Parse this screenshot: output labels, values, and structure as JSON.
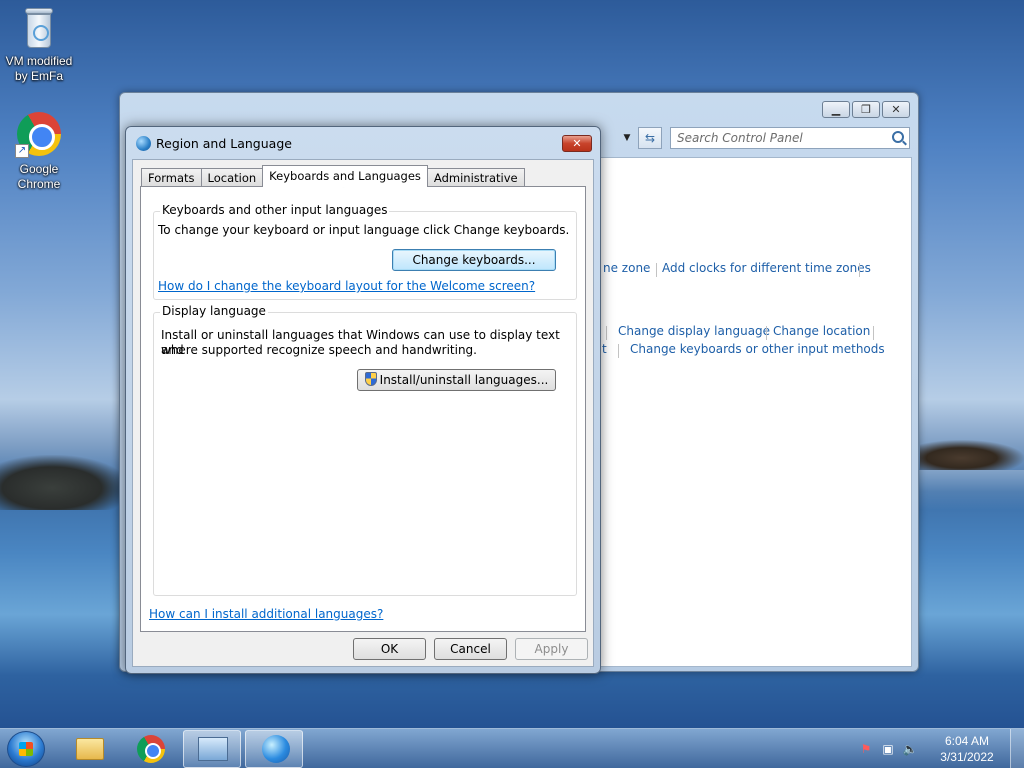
{
  "desktop": {
    "icons": [
      {
        "label": "VM modified by EmFa"
      },
      {
        "label": "Google Chrome"
      }
    ]
  },
  "control_panel": {
    "search_placeholder": "Search Control Panel",
    "links": {
      "time_zone_fragment": "ne zone",
      "add_clocks": "Add clocks for different time zones",
      "change_display_language": "Change display language",
      "change_location": "Change location",
      "fragment_t": "t",
      "change_keyboards": "Change keyboards or other input methods"
    }
  },
  "dialog": {
    "title": "Region and Language",
    "tabs": [
      "Formats",
      "Location",
      "Keyboards and Languages",
      "Administrative"
    ],
    "active_tab": "Keyboards and Languages",
    "keyboards_group": {
      "title": "Keyboards and other input languages",
      "description": "To change your keyboard or input language click Change keyboards.",
      "change_button": "Change keyboards...",
      "help_link": "How do I change the keyboard layout for the Welcome screen?"
    },
    "display_group": {
      "title": "Display language",
      "description_line1": "Install or uninstall languages that Windows can use to display text and",
      "description_line2": "where supported recognize speech and handwriting.",
      "install_button": "Install/uninstall languages..."
    },
    "additional_link": "How can I install additional languages?",
    "buttons": {
      "ok": "OK",
      "cancel": "Cancel",
      "apply": "Apply"
    }
  },
  "taskbar": {
    "time": "6:04 AM",
    "date": "3/31/2022"
  }
}
